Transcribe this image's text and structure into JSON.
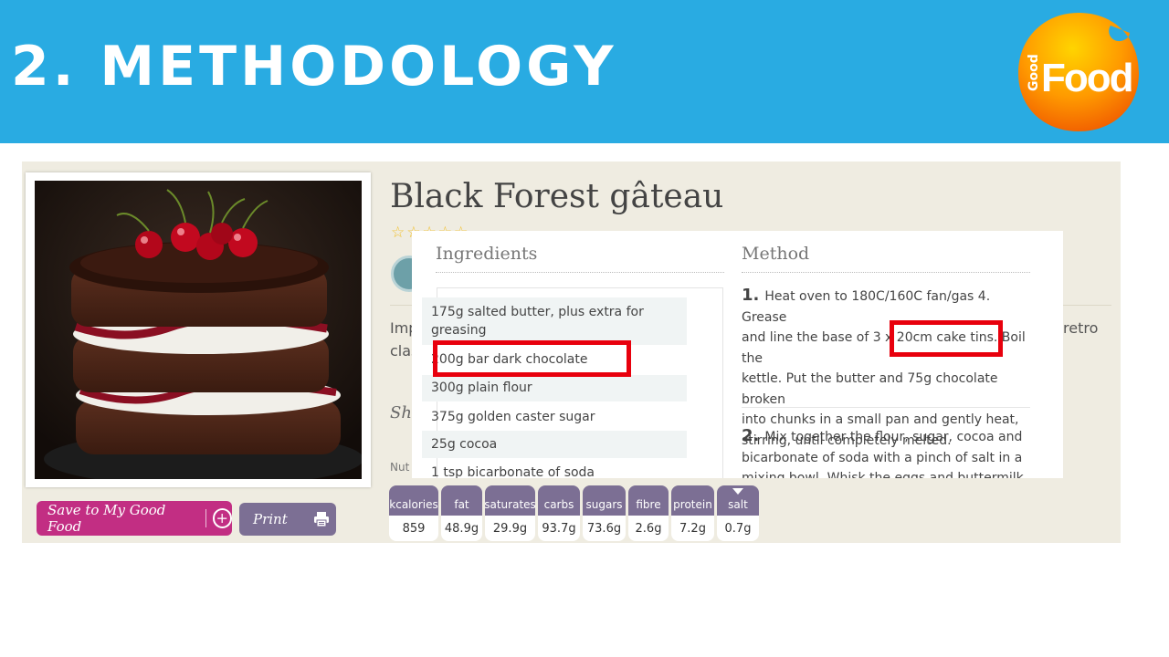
{
  "slide": {
    "title": "2. METHODOLOGY",
    "logo": {
      "icon": "good-food-logo",
      "small_text": "Good",
      "big_text": "Food"
    }
  },
  "recipe": {
    "title": "Black Forest gâteau",
    "description_fragment_left_1": "Imp",
    "description_fragment_left_2": "clas",
    "description_fragment_right": "retro",
    "share_fragment": "Sh",
    "nutrition_fragment": "Nut",
    "buttons": {
      "save": "Save to My Good Food",
      "print": "Print"
    }
  },
  "overlay": {
    "ingredients_heading": "Ingredients",
    "method_heading": "Method",
    "ingredients": [
      {
        "line1": "175g salted butter, plus extra for",
        "line2": "greasing"
      },
      {
        "line1": "200g bar dark chocolate"
      },
      {
        "line1": "300g plain flour"
      },
      {
        "line1": "375g golden caster sugar"
      },
      {
        "line1": "25g cocoa"
      },
      {
        "line1": "1 tsp bicarbonate of soda"
      }
    ],
    "steps": [
      {
        "num": "1.",
        "lines": [
          "Heat oven to 180C/160C fan/gas 4. Grease",
          "and line the base of 3 x 20cm cake tins. Boil the",
          "kettle. Put the butter and 75g chocolate broken",
          "into chunks in a small pan and gently heat,",
          "stirring, until completely melted."
        ]
      },
      {
        "num": "2.",
        "lines": [
          "Mix together the flour, sugar, cocoa and",
          "bicarbonate of soda with a pinch of salt in a",
          "mixing bowl. Whisk the eggs and buttermilk or"
        ]
      }
    ]
  },
  "nutrition": [
    {
      "label": "kcalories",
      "value": "859"
    },
    {
      "label": "fat",
      "value": "48.9g"
    },
    {
      "label": "saturates",
      "value": "29.9g"
    },
    {
      "label": "carbs",
      "value": "93.7g"
    },
    {
      "label": "sugars",
      "value": "73.6g"
    },
    {
      "label": "fibre",
      "value": "2.6g"
    },
    {
      "label": "protein",
      "value": "7.2g"
    },
    {
      "label": "salt",
      "value": "0.7g"
    }
  ],
  "colors": {
    "banner": "#29abe2",
    "highlight": "#e8000d",
    "save_button": "#c22e83",
    "nutrition": "#7c6f94"
  }
}
